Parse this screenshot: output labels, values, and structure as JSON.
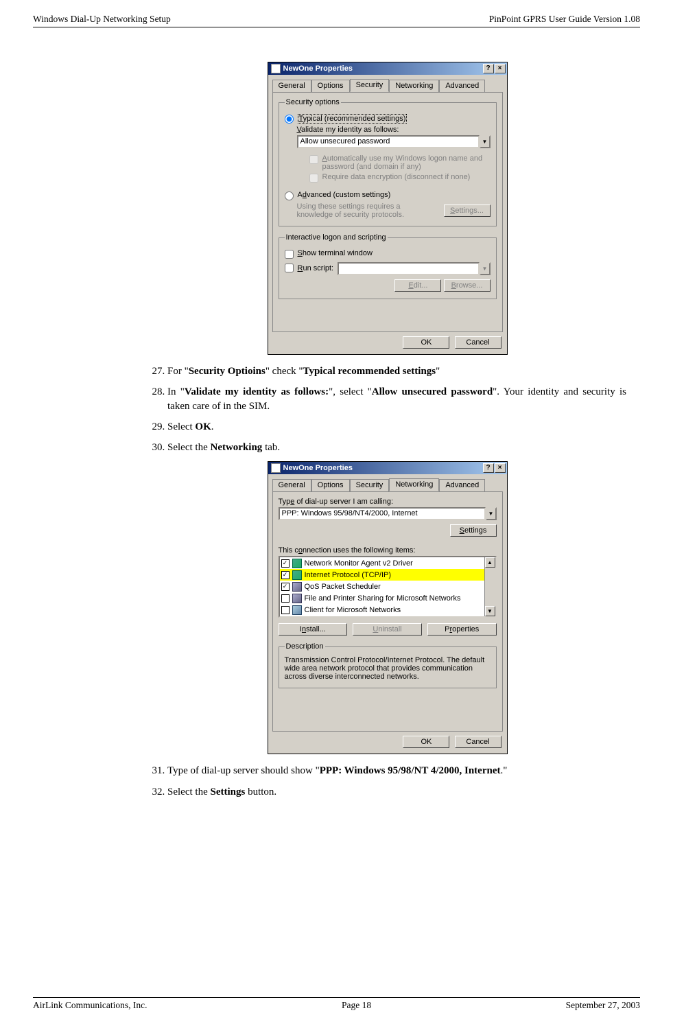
{
  "header": {
    "left": "Windows Dial-Up Networking Setup",
    "right": "PinPoint GPRS User Guide Version 1.08"
  },
  "dialog1": {
    "title": "NewOne Properties",
    "help_glyph": "?",
    "close_glyph": "×",
    "tabs": [
      "General",
      "Options",
      "Security",
      "Networking",
      "Advanced"
    ],
    "active_tab_index": 2,
    "group1_legend": "Security options",
    "radio_typical_pre": "T",
    "radio_typical_rest": "ypical (recommended settings)",
    "validate_label_pre": "V",
    "validate_label_rest": "alidate my identity as follows:",
    "validate_value": "Allow unsecured password",
    "chk_auto_pre": "A",
    "chk_auto_rest": "utomatically use my Windows logon name and password (and domain if any)",
    "chk_encr_text": "Require data encryption (disconnect if none)",
    "radio_adv_pre": "A",
    "radio_adv_mid": "d",
    "radio_adv_rest": "vanced (custom settings)",
    "adv_note": "Using these settings requires a knowledge of security protocols.",
    "settings_btn_pre": "S",
    "settings_btn_rest": "ettings...",
    "group2_legend": "Interactive logon and scripting",
    "chk_show_pre": "S",
    "chk_show_rest": "how terminal window",
    "chk_run_pre": "R",
    "chk_run_rest": "un script:",
    "edit_btn_pre": "E",
    "edit_btn_rest": "dit...",
    "browse_btn_pre": "B",
    "browse_btn_rest": "rowse...",
    "ok": "OK",
    "cancel": "Cancel"
  },
  "steps_a": [
    {
      "n": "27.",
      "pre": "For \"",
      "b1": "Security Optioins",
      "mid": "\" check \"",
      "b2": "Typical recommended settings",
      "post": "\""
    },
    {
      "n": "28.",
      "pre": "In \"",
      "b1": "Validate my identity as follows:",
      "mid": "\", select \"",
      "b2": "Allow unsecured password",
      "post": "\". Your identity and security is taken care of in the SIM."
    },
    {
      "n": "29.",
      "pre": "Select ",
      "b1": "OK",
      "post": "."
    },
    {
      "n": "30.",
      "pre": "Select the ",
      "b1": "Networking",
      "post": " tab."
    }
  ],
  "dialog2": {
    "title": "NewOne Properties",
    "tabs": [
      "General",
      "Options",
      "Security",
      "Networking",
      "Advanced"
    ],
    "active_tab_index": 3,
    "type_label_pre": "Typ",
    "type_label_ul": "e",
    "type_label_rest": " of dial-up server I am calling:",
    "type_value": "PPP: Windows 95/98/NT4/2000, Internet",
    "settings_btn_pre": "S",
    "settings_btn_rest": "ettings",
    "uses_label_pre": "This c",
    "uses_label_ul": "o",
    "uses_label_rest": "nnection uses the following items:",
    "items": [
      {
        "checked": true,
        "icon": "net",
        "label": "Network Monitor Agent v2 Driver",
        "hl": false
      },
      {
        "checked": true,
        "icon": "net",
        "label": "Internet Protocol (TCP/IP)",
        "hl": true
      },
      {
        "checked": true,
        "icon": "svc",
        "label": "QoS Packet Scheduler",
        "hl": false
      },
      {
        "checked": false,
        "icon": "svc",
        "label": "File and Printer Sharing for Microsoft Networks",
        "hl": false
      },
      {
        "checked": false,
        "icon": "cli",
        "label": "Client for Microsoft Networks",
        "hl": false
      }
    ],
    "install_pre": "I",
    "install_ul": "n",
    "install_rest": "stall...",
    "uninstall_pre": "U",
    "uninstall_rest": "ninstall",
    "properties_pre": "P",
    "properties_ul": "r",
    "properties_rest": "operties",
    "desc_legend": "Description",
    "desc_text": "Transmission Control Protocol/Internet Protocol. The default wide area network protocol that provides communication across diverse interconnected networks.",
    "ok": "OK",
    "cancel": "Cancel"
  },
  "steps_b": [
    {
      "n": "31.",
      "pre": "Type of dial-up server should show \"",
      "b1": "PPP: Windows 95/98/NT 4/2000, Internet",
      "post": ".\""
    },
    {
      "n": "32.",
      "pre": "Select the ",
      "b1": "Settings",
      "post": " button."
    }
  ],
  "footer": {
    "left": "AirLink Communications, Inc.",
    "mid": "Page 18",
    "right": "September 27, 2003"
  }
}
